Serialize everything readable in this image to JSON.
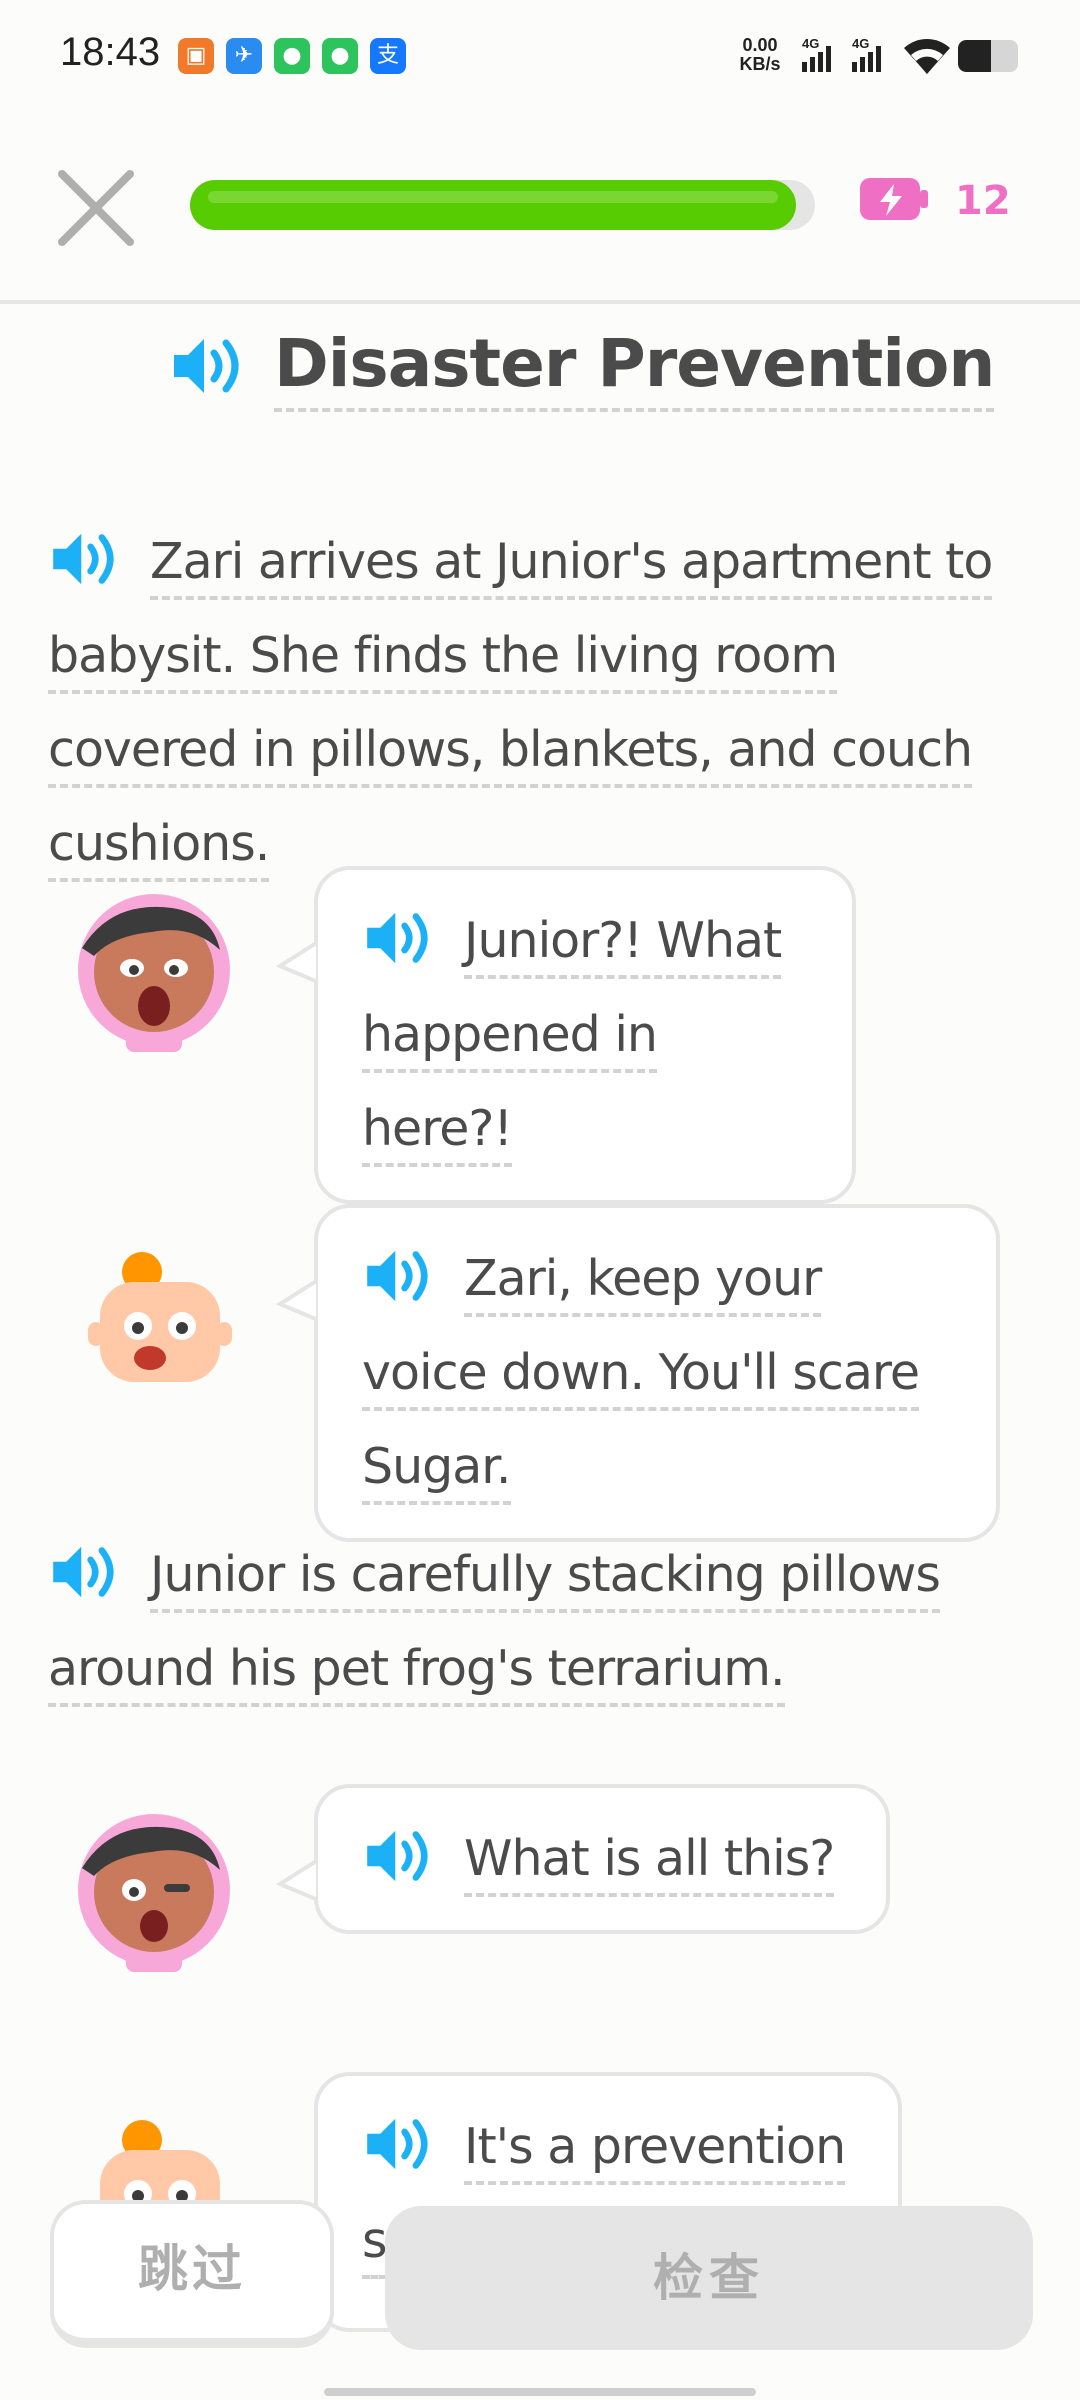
{
  "status_bar": {
    "time": "18:43",
    "net_speed_value": "0.00",
    "net_speed_unit": "KB/s",
    "signal_1_label": "4G",
    "signal_2_label": "4G",
    "battery_level": 0.55,
    "notification_icons": [
      "app-icon-orange",
      "app-icon-blue",
      "wechat-icon",
      "wechat-icon",
      "alipay-icon"
    ]
  },
  "header": {
    "progress": 0.97,
    "energy_count": "12",
    "colors": {
      "progress": "#58cc02",
      "energy": "#ee6fc4"
    }
  },
  "story": {
    "title": "Disaster Prevention",
    "lines": [
      {
        "type": "narration",
        "text": "Zari arrives at Junior's apartment to babysit. She finds the living room covered in pillows, blankets, and couch cushions."
      },
      {
        "type": "dialogue",
        "speaker": "zari",
        "text": "Junior?! What happened in here?!"
      },
      {
        "type": "dialogue",
        "speaker": "junior",
        "text": "Zari, keep your voice down. You'll scare Sugar."
      },
      {
        "type": "narration",
        "text": "Junior is carefully stacking pillows around his pet frog's terrarium."
      },
      {
        "type": "dialogue",
        "speaker": "zari",
        "text": "What is all this?"
      },
      {
        "type": "dialogue",
        "speaker": "junior",
        "text": "It's a prevention s"
      }
    ]
  },
  "footer": {
    "skip_label": "跳过",
    "check_label": "检查"
  },
  "colors": {
    "accent_blue": "#1cb0f6",
    "text": "#4b4b4b"
  }
}
